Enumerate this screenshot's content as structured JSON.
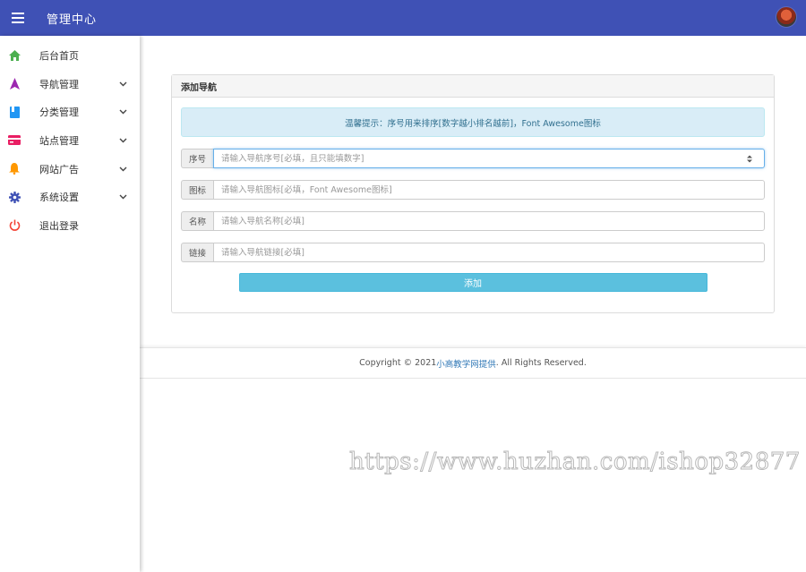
{
  "topbar": {
    "title": "管理中心",
    "accent_color": "#3f51b5"
  },
  "sidebar": {
    "items": [
      {
        "label": "后台首页",
        "icon": "home-icon",
        "color": "#4caf50",
        "has_submenu": false
      },
      {
        "label": "导航管理",
        "icon": "navigation-arrow-icon",
        "color": "#9c27b0",
        "has_submenu": true
      },
      {
        "label": "分类管理",
        "icon": "book-icon",
        "color": "#2196f3",
        "has_submenu": true
      },
      {
        "label": "站点管理",
        "icon": "credit-card-icon",
        "color": "#e91e63",
        "has_submenu": true
      },
      {
        "label": "网站广告",
        "icon": "bell-icon",
        "color": "#ff9800",
        "has_submenu": true
      },
      {
        "label": "系统设置",
        "icon": "gear-icon",
        "color": "#3f51b5",
        "has_submenu": true
      },
      {
        "label": "退出登录",
        "icon": "power-icon",
        "color": "#f44336",
        "has_submenu": false
      }
    ]
  },
  "panel": {
    "title": "添加导航",
    "alert": "温馨提示：序号用来排序[数字越小排名越前]，Font Awesome图标",
    "fields": [
      {
        "label": "序号",
        "placeholder": "请输入导航序号[必填，且只能填数字]"
      },
      {
        "label": "图标",
        "placeholder": "请输入导航图标[必填，Font Awesome图标]"
      },
      {
        "label": "名称",
        "placeholder": "请输入导航名称[必填]"
      },
      {
        "label": "链接",
        "placeholder": "请输入导航链接[必填]"
      }
    ],
    "submit_label": "添加"
  },
  "footer": {
    "prefix": "Copyright © 2021 ",
    "link": "小高教学网提供",
    "suffix": ". All Rights Reserved."
  },
  "watermark": "https://www.huzhan.com/ishop32877"
}
